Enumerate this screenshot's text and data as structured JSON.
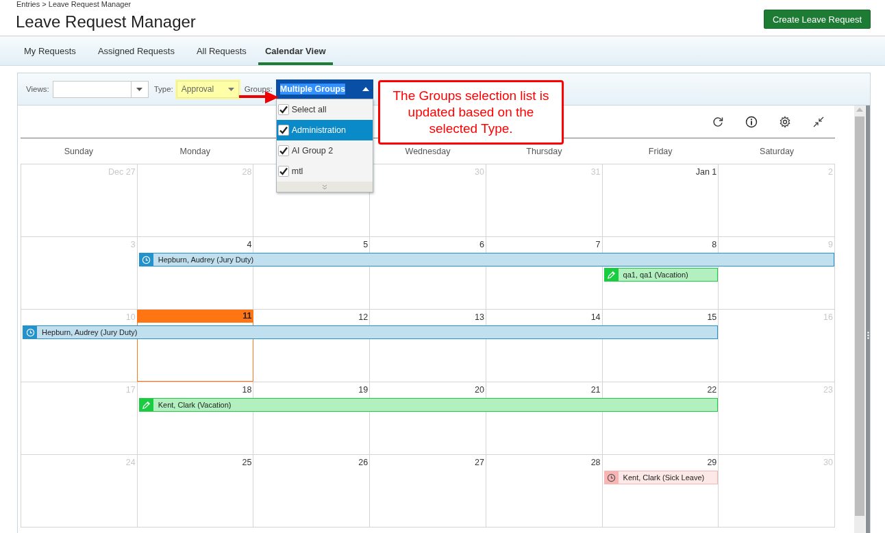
{
  "breadcrumb": "Entries > Leave Request Manager",
  "title": "Leave Request Manager",
  "create_button": "Create Leave Request",
  "tabs": [
    {
      "label": "My Requests",
      "selected": false
    },
    {
      "label": "Assigned Requests",
      "selected": false
    },
    {
      "label": "All Requests",
      "selected": false
    },
    {
      "label": "Calendar View",
      "selected": true
    }
  ],
  "filters": {
    "views": {
      "label": "Views:"
    },
    "type": {
      "label": "Type:",
      "value": "Approval",
      "highlighted": true
    },
    "groups": {
      "label": "Groups:",
      "value": "Multiple Groups",
      "expanded": true,
      "options": [
        {
          "label": "Select all",
          "checked": true,
          "selected": false
        },
        {
          "label": "Administration",
          "checked": true,
          "selected": true
        },
        {
          "label": "AI Group 2",
          "checked": true,
          "selected": false
        },
        {
          "label": "mtl",
          "checked": true,
          "selected": false
        }
      ]
    }
  },
  "callout": "The Groups selection list is updated based on the selected Type.",
  "calendar": {
    "weekdays": {
      "sun": "Sunday",
      "mon": "Monday",
      "wed": "Wednesday",
      "thu": "Thursday",
      "fri": "Friday",
      "sat": "Saturday"
    },
    "weeks": [
      {
        "days": {
          "sun": {
            "label": "Dec 27",
            "kind": "other"
          },
          "mon": {
            "label": "28",
            "kind": "other"
          },
          "wed": {
            "label": "30",
            "kind": "other"
          },
          "thu": {
            "label": "31",
            "kind": "other"
          },
          "fri": {
            "label": "Jan 1",
            "kind": "current"
          },
          "sat": {
            "label": "2",
            "kind": "other"
          }
        }
      },
      {
        "days": {
          "sun": {
            "label": "3",
            "kind": "other"
          },
          "mon": {
            "label": "4",
            "kind": "current"
          },
          "tue": {
            "label": "5",
            "kind": "current"
          },
          "wed": {
            "label": "6",
            "kind": "current"
          },
          "thu": {
            "label": "7",
            "kind": "current"
          },
          "fri": {
            "label": "8",
            "kind": "current"
          },
          "sat": {
            "label": "9",
            "kind": "other"
          }
        },
        "events": [
          {
            "label": "Hepburn, Audrey (Jury Duty)",
            "kind": "pending",
            "color": "#c0e0f0",
            "on_days": [
              false,
              true,
              true,
              true,
              true,
              true,
              true
            ]
          },
          {
            "label": "qa1, qa1 (Vacation)",
            "kind": "draft",
            "color": "#b3f0c0",
            "on_days": [
              false,
              false,
              false,
              false,
              false,
              true,
              false
            ]
          }
        ]
      },
      {
        "days": {
          "sun": {
            "label": "10",
            "kind": "other"
          },
          "mon": {
            "label": "11",
            "kind": "today"
          },
          "tue": {
            "label": "12",
            "kind": "current"
          },
          "wed": {
            "label": "13",
            "kind": "current"
          },
          "thu": {
            "label": "14",
            "kind": "current"
          },
          "fri": {
            "label": "15",
            "kind": "current"
          },
          "sat": {
            "label": "16",
            "kind": "other"
          }
        },
        "events": [
          {
            "label": "Hepburn, Audrey (Jury Duty)",
            "kind": "pending",
            "color": "#c0e0f0",
            "on_days": [
              true,
              true,
              true,
              true,
              true,
              true,
              false
            ]
          }
        ]
      },
      {
        "days": {
          "sun": {
            "label": "17",
            "kind": "other"
          },
          "mon": {
            "label": "18",
            "kind": "current"
          },
          "tue": {
            "label": "19",
            "kind": "current"
          },
          "wed": {
            "label": "20",
            "kind": "current"
          },
          "thu": {
            "label": "21",
            "kind": "current"
          },
          "fri": {
            "label": "22",
            "kind": "current"
          },
          "sat": {
            "label": "23",
            "kind": "other"
          }
        },
        "events": [
          {
            "label": "Kent, Clark (Vacation)",
            "kind": "draft",
            "color": "#b3f0c0",
            "on_days": [
              false,
              true,
              true,
              true,
              true,
              true,
              false
            ]
          }
        ]
      },
      {
        "days": {
          "sun": {
            "label": "24",
            "kind": "other"
          },
          "mon": {
            "label": "25",
            "kind": "current"
          },
          "tue": {
            "label": "26",
            "kind": "current"
          },
          "wed": {
            "label": "27",
            "kind": "current"
          },
          "thu": {
            "label": "28",
            "kind": "current"
          },
          "fri": {
            "label": "29",
            "kind": "current"
          },
          "sat": {
            "label": "30",
            "kind": "other"
          }
        },
        "events": [
          {
            "label": "Kent, Clark (Sick Leave)",
            "kind": "pending",
            "color": "#fde8e8",
            "on_days": [
              false,
              false,
              false,
              false,
              false,
              true,
              false
            ]
          }
        ]
      }
    ]
  }
}
